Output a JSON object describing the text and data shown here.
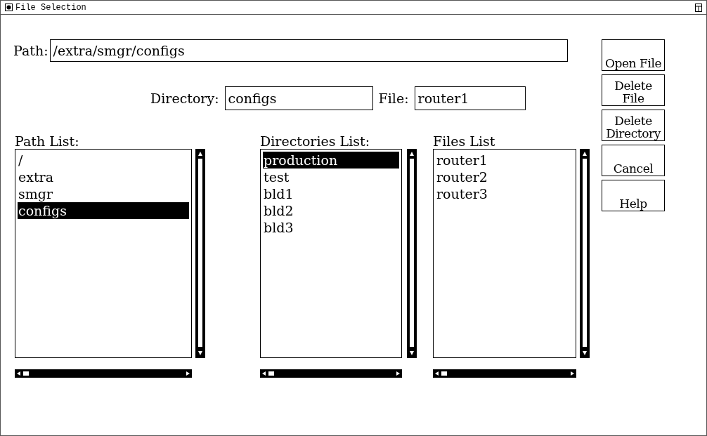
{
  "window": {
    "title": "File Selection"
  },
  "path": {
    "label": "Path:",
    "value": "/extra/smgr/configs"
  },
  "directory": {
    "label": "Directory:",
    "value": "configs"
  },
  "file": {
    "label": "File:",
    "value": "router1"
  },
  "lists": [
    {
      "title": "Path List:",
      "items": [
        {
          "text": "/",
          "selected": false
        },
        {
          "text": "extra",
          "selected": false
        },
        {
          "text": "smgr",
          "selected": false
        },
        {
          "text": "configs",
          "selected": true
        }
      ]
    },
    {
      "title": "Directories List:",
      "items": [
        {
          "text": "production",
          "selected": true
        },
        {
          "text": "test",
          "selected": false
        },
        {
          "text": "bld1",
          "selected": false
        },
        {
          "text": "bld2",
          "selected": false
        },
        {
          "text": "bld3",
          "selected": false
        }
      ]
    },
    {
      "title": "Files List",
      "items": [
        {
          "text": "router1",
          "selected": false
        },
        {
          "text": "router2",
          "selected": false
        },
        {
          "text": "router3",
          "selected": false
        }
      ]
    }
  ],
  "buttons": [
    "Open File",
    "Delete File",
    "Delete Directory",
    "Cancel",
    "Help"
  ]
}
